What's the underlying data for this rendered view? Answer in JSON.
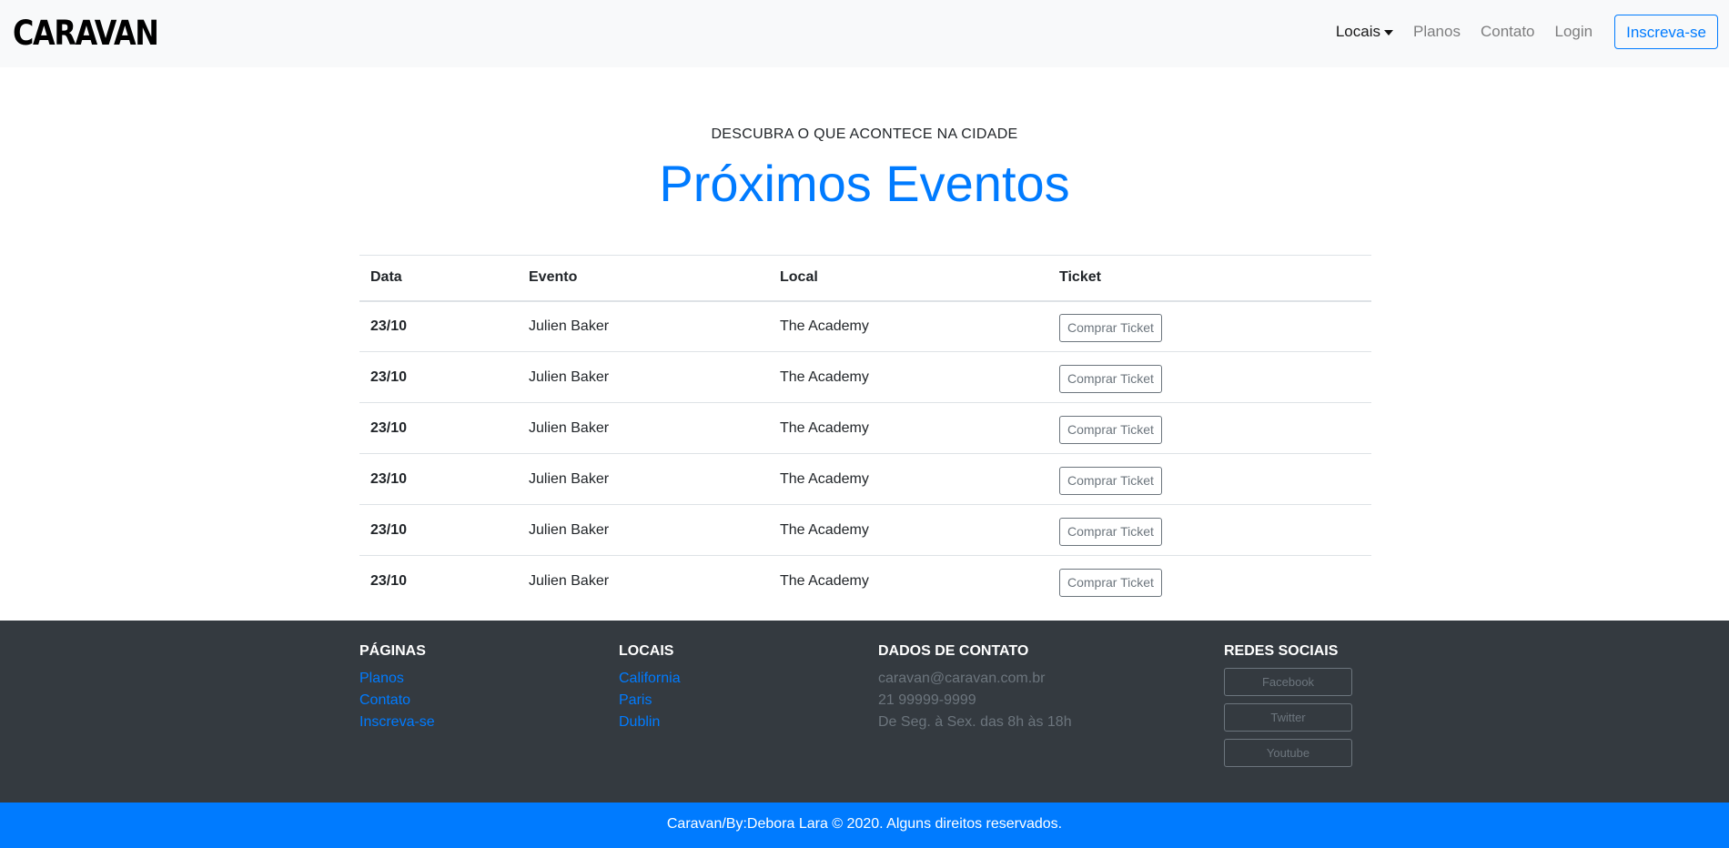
{
  "navbar": {
    "brand": "CARAVAN",
    "links": {
      "locais": "Locais",
      "planos": "Planos",
      "contato": "Contato",
      "login": "Login"
    },
    "signup": "Inscreva-se"
  },
  "hero": {
    "subtitle": "DESCUBRA O QUE ACONTECE NA CIDADE",
    "title": "Próximos Eventos"
  },
  "events_table": {
    "headers": {
      "data": "Data",
      "evento": "Evento",
      "local": "Local",
      "ticket": "Ticket"
    },
    "rows": [
      {
        "data": "23/10",
        "evento": "Julien Baker",
        "local": "The Academy",
        "ticket": "Comprar Ticket"
      },
      {
        "data": "23/10",
        "evento": "Julien Baker",
        "local": "The Academy",
        "ticket": "Comprar Ticket"
      },
      {
        "data": "23/10",
        "evento": "Julien Baker",
        "local": "The Academy",
        "ticket": "Comprar Ticket"
      },
      {
        "data": "23/10",
        "evento": "Julien Baker",
        "local": "The Academy",
        "ticket": "Comprar Ticket"
      },
      {
        "data": "23/10",
        "evento": "Julien Baker",
        "local": "The Academy",
        "ticket": "Comprar Ticket"
      },
      {
        "data": "23/10",
        "evento": "Julien Baker",
        "local": "The Academy",
        "ticket": "Comprar Ticket"
      }
    ]
  },
  "footer": {
    "paginas": {
      "heading": "PÁGINAS",
      "links": [
        "Planos",
        "Contato",
        "Inscreva-se"
      ]
    },
    "locais": {
      "heading": "LOCAIS",
      "links": [
        "California",
        "Paris",
        "Dublin"
      ]
    },
    "contato": {
      "heading": "DADOS DE CONTATO",
      "lines": [
        "caravan@caravan.com.br",
        "21 99999-9999",
        "De Seg. à Sex. das 8h às 18h"
      ]
    },
    "redes": {
      "heading": "REDES SOCIAIS",
      "buttons": [
        "Facebook",
        "Twitter",
        "Youtube"
      ]
    },
    "copyright": "Caravan/By:Debora Lara © 2020. Alguns direitos reservados."
  },
  "colors": {
    "primary": "#007bff",
    "navbar_bg": "#f8f9fa",
    "footer_bg": "#343a40",
    "muted": "#6c757d"
  }
}
